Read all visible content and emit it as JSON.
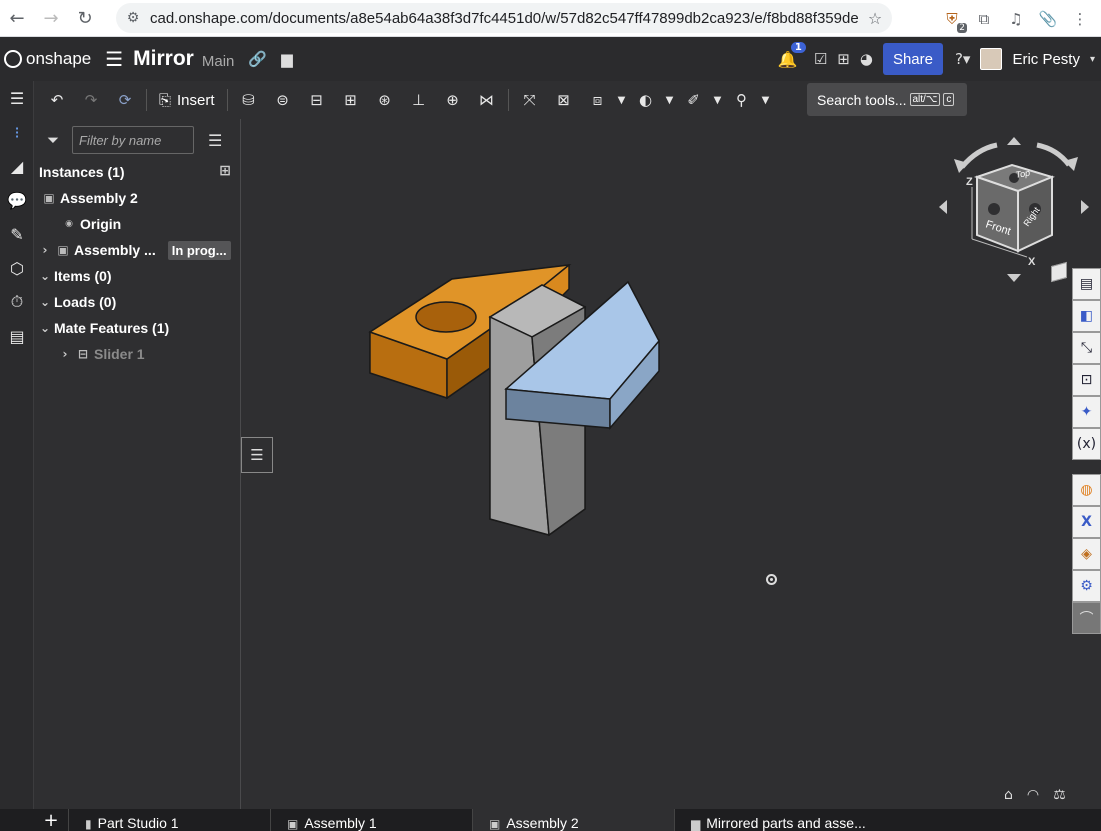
{
  "browser": {
    "url": "cad.onshape.com/documents/a8e54ab64a38f3d7fc4451d0/w/57d82c547ff47899db2ca923/e/f8bd88f359ded37...",
    "extension_badge": "2"
  },
  "header": {
    "logo_text": "onshape",
    "doc_title": "Mirror",
    "branch": "Main",
    "notification_count": "1",
    "share_label": "Share",
    "user_name": "Eric Pesty"
  },
  "toolbar": {
    "insert_label": "Insert",
    "search_label": "Search tools...",
    "search_kbd_1": "alt/⌥",
    "search_kbd_2": "c"
  },
  "panel": {
    "filter_placeholder": "Filter by name",
    "instances_heading": "Instances (1)",
    "tree": [
      {
        "label": "Assembly 2"
      },
      {
        "label": "Origin"
      },
      {
        "label": "Assembly ...",
        "status": "In prog..."
      },
      {
        "label": "Items (0)"
      },
      {
        "label": "Loads (0)"
      },
      {
        "label": "Mate Features (1)"
      },
      {
        "label": "Slider 1"
      }
    ]
  },
  "view_cube": {
    "top_label": "Top",
    "front_label": "Front",
    "right_label": "Right",
    "axis_z": "Z",
    "axis_x": "X"
  },
  "tabs": [
    {
      "label": "Part Studio 1"
    },
    {
      "label": "Assembly 1"
    },
    {
      "label": "Assembly 2",
      "active": true
    },
    {
      "label": "Mirrored parts and asse..."
    }
  ],
  "colors": {
    "orange_part": "#d9891e",
    "blue_part": "#a9c6e8",
    "gray_part": "#a0a0a0",
    "share_button": "#3a5bc7"
  }
}
